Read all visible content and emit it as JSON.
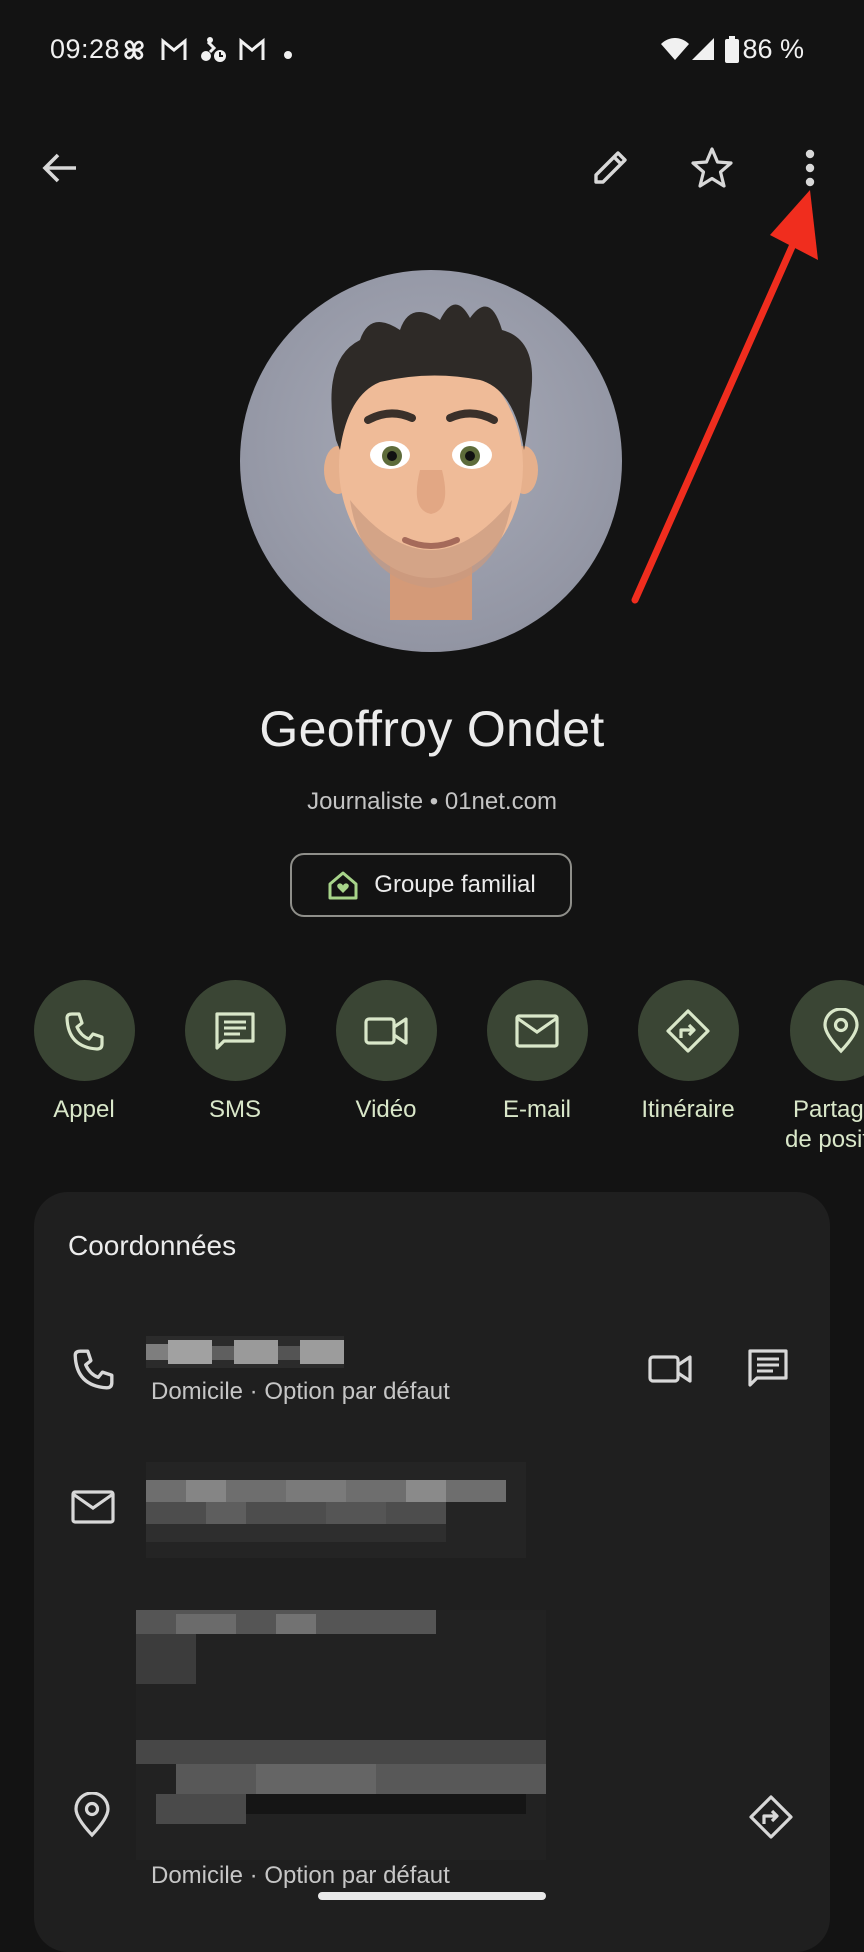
{
  "status_bar": {
    "time": "09:28",
    "icons": [
      "pinwheel-icon",
      "gmail-icon",
      "bike-clock-icon",
      "gmail-icon",
      "dot-icon"
    ],
    "battery": "86 %"
  },
  "top_bar": {
    "back": "back-arrow-icon",
    "edit": "pencil-icon",
    "favorite": "star-icon",
    "more": "more-vert-icon"
  },
  "contact": {
    "name": "Geoffroy Ondet",
    "subtitle": "Journaliste • 01net.com",
    "group_chip": "Groupe familial"
  },
  "actions": [
    {
      "label": "Appel",
      "icon": "phone-icon"
    },
    {
      "label": "SMS",
      "icon": "message-icon"
    },
    {
      "label": "Vidéo",
      "icon": "video-icon"
    },
    {
      "label": "E-mail",
      "icon": "mail-icon"
    },
    {
      "label": "Itinéraire",
      "icon": "directions-icon"
    },
    {
      "label_line1": "Partag",
      "label_line2": "de posit",
      "icon": "location-icon"
    }
  ],
  "details_card": {
    "title": "Coordonnées",
    "phone_caption": "Domicile · Option par défaut",
    "address_caption": "Domicile · Option par défaut"
  },
  "colors": {
    "background": "#131313",
    "card": "#1f1f1f",
    "action_circle": "#3a4534",
    "action_label": "#d9e7c9",
    "annotation_arrow": "#f02d1e"
  }
}
